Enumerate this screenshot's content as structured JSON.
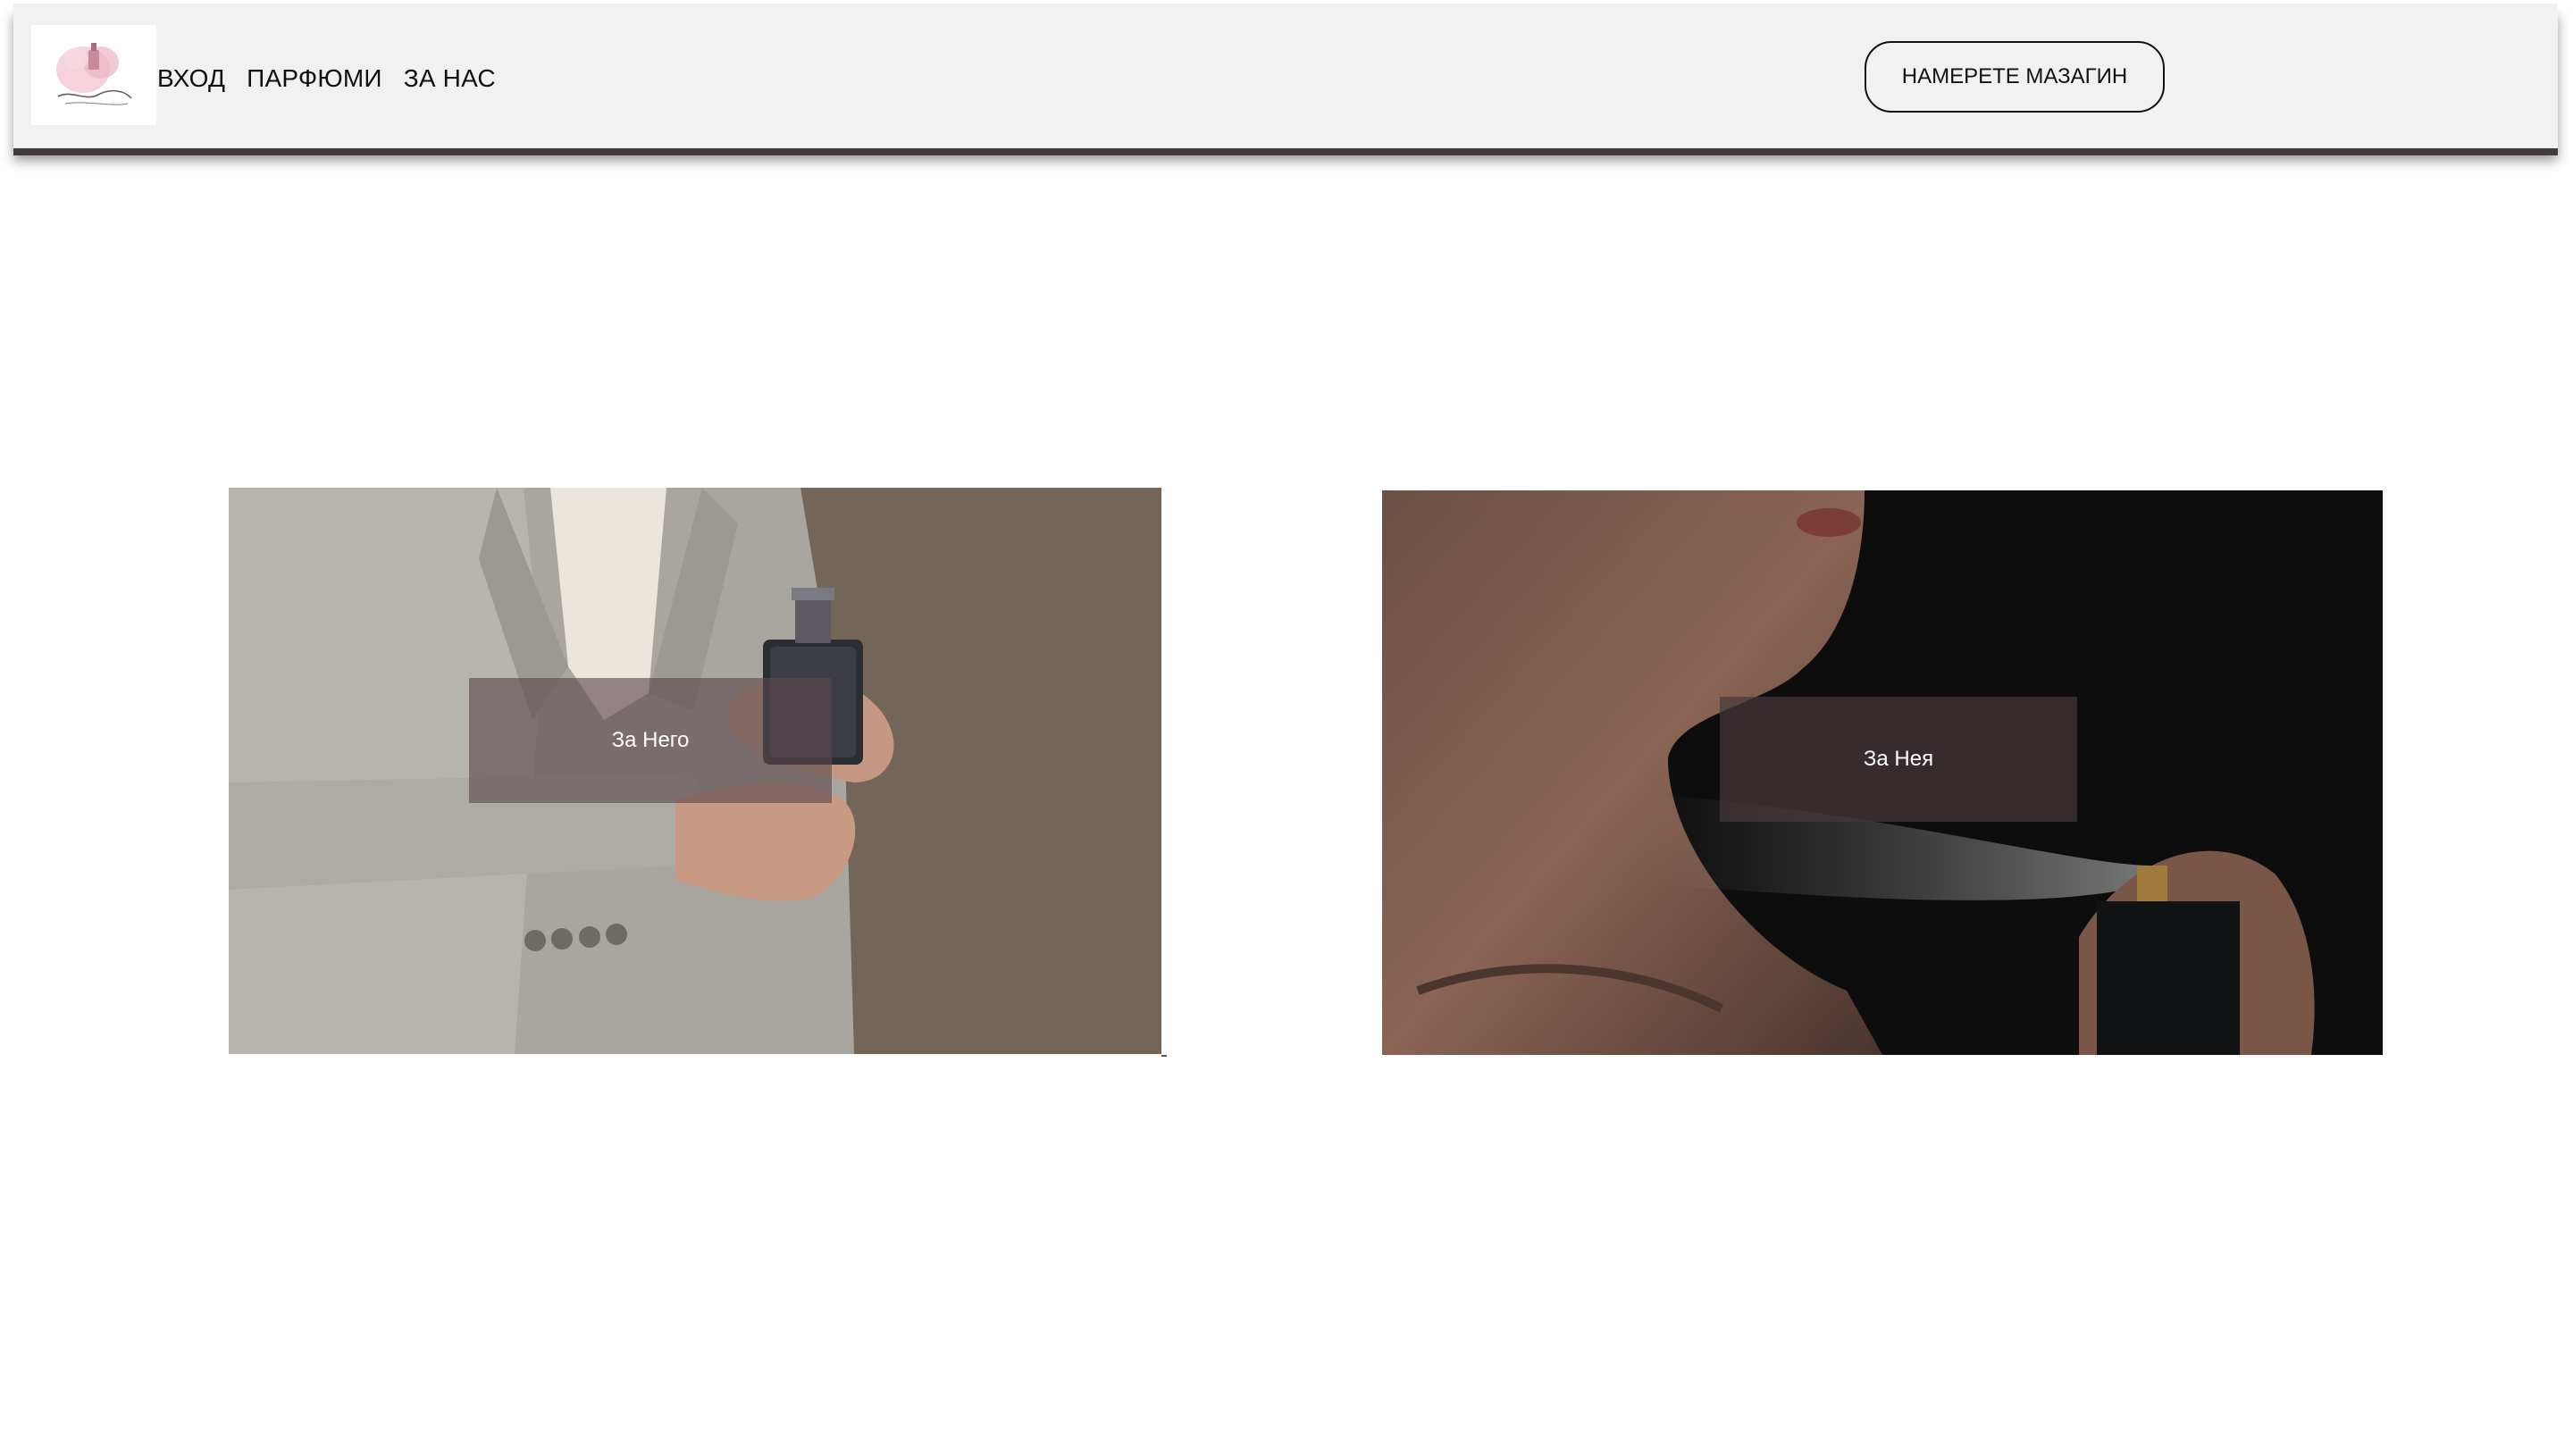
{
  "header": {
    "logo_alt": "Perfumes logo",
    "nav": [
      {
        "label": "ВХОД"
      },
      {
        "label": "ПАРФЮМИ"
      },
      {
        "label": "ЗА НАС"
      }
    ],
    "store_button_label": "НАМЕРЕТЕ МАЗАГИН"
  },
  "cards": [
    {
      "label": "За Него"
    },
    {
      "label": "За Нея"
    }
  ],
  "colors": {
    "header_bg": "#f1f1f1",
    "header_shadow": "#433a40",
    "him_bg": "#736659",
    "her_bg": "#0c0d0c"
  }
}
